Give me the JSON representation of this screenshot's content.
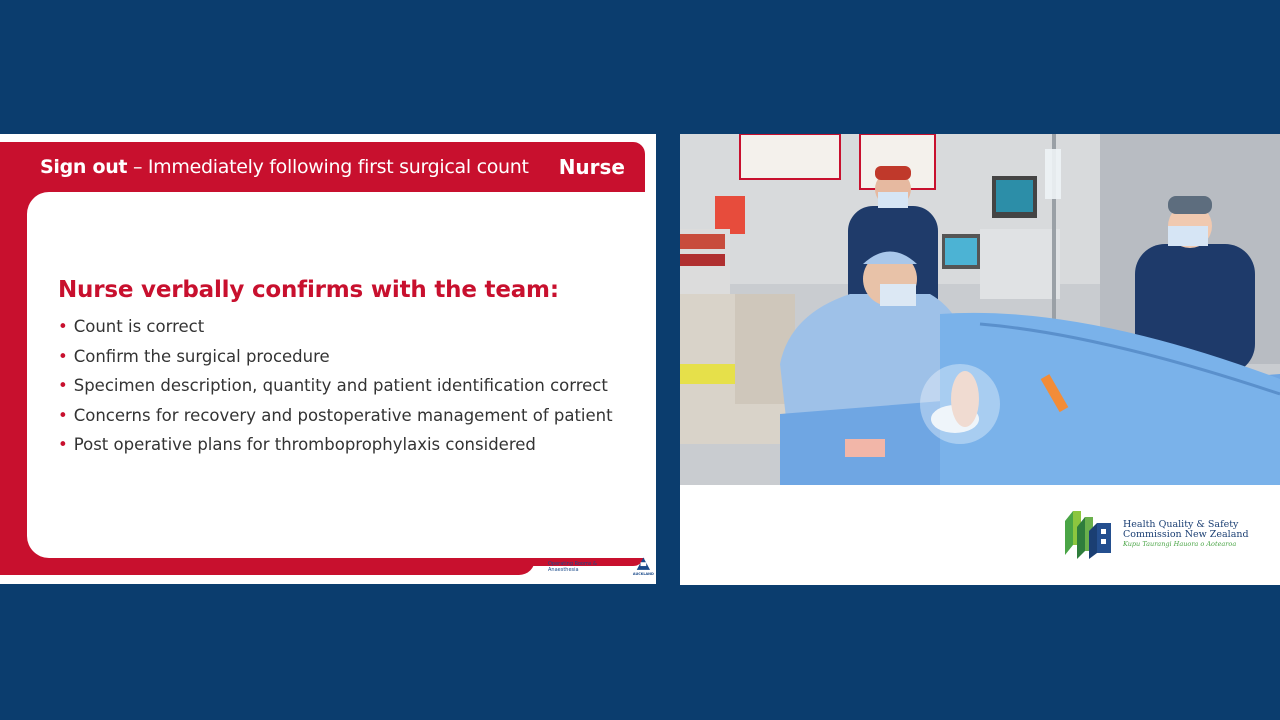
{
  "slide": {
    "header_bold": "Sign out",
    "header_rest": " – Immediately following first surgical count",
    "header_role": "Nurse",
    "heading": "Nurse verbally confirms with the team:",
    "bullets": [
      "Count is correct",
      "Confirm the surgical procedure",
      "Specimen description, quantity and patient identification correct",
      "Concerns for recovery and postoperative management of patient",
      "Post operative plans for thromboprophylaxis considered"
    ],
    "footer": {
      "dept": "Operating Rooms & Anaesthesia",
      "org_label": "AUCKLAND"
    }
  },
  "video_panel": {
    "logo_line1": "Health Quality & Safety",
    "logo_line2": "Commission New Zealand",
    "logo_maori": "Kupu Taurangi Hauora o Aotearoa"
  },
  "colors": {
    "background": "#0b3d6e",
    "accent_red": "#c8102e",
    "hqsc_blue": "#1b3f73",
    "hqsc_green": "#4aa546"
  }
}
